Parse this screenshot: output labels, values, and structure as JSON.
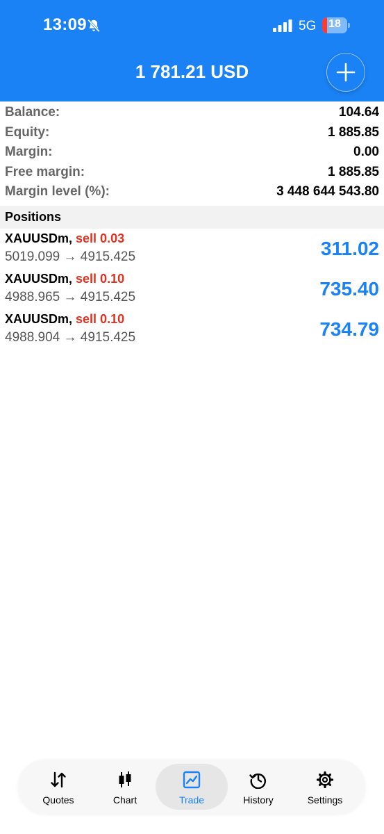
{
  "status_bar": {
    "time": "13:09",
    "network": "5G",
    "battery": "18"
  },
  "header": {
    "equity_title": "1 781.21 USD"
  },
  "summary": [
    {
      "label": "Balance:",
      "value": "104.64"
    },
    {
      "label": "Equity:",
      "value": "1 885.85"
    },
    {
      "label": "Margin:",
      "value": "0.00"
    },
    {
      "label": "Free margin:",
      "value": "1 885.85"
    },
    {
      "label": "Margin level (%):",
      "value": "3 448 644 543.80"
    }
  ],
  "positions_title": "Positions",
  "positions": [
    {
      "symbol": "XAUUSDm,",
      "side": "sell 0.03",
      "prices": "5019.099 → 4915.425",
      "profit": "311.02"
    },
    {
      "symbol": "XAUUSDm,",
      "side": "sell 0.10",
      "prices": "4988.965 → 4915.425",
      "profit": "735.40"
    },
    {
      "symbol": "XAUUSDm,",
      "side": "sell 0.10",
      "prices": "4988.904 → 4915.425",
      "profit": "734.79"
    }
  ],
  "tabs": [
    {
      "label": "Quotes",
      "icon": "quotes-arrows-icon"
    },
    {
      "label": "Chart",
      "icon": "candlestick-icon"
    },
    {
      "label": "Trade",
      "icon": "trade-chart-icon",
      "active": true
    },
    {
      "label": "History",
      "icon": "history-clock-icon"
    },
    {
      "label": "Settings",
      "icon": "gear-icon"
    }
  ],
  "colors": {
    "accent": "#1a82f5",
    "sell": "#e0321f",
    "label_gray": "#666666"
  }
}
